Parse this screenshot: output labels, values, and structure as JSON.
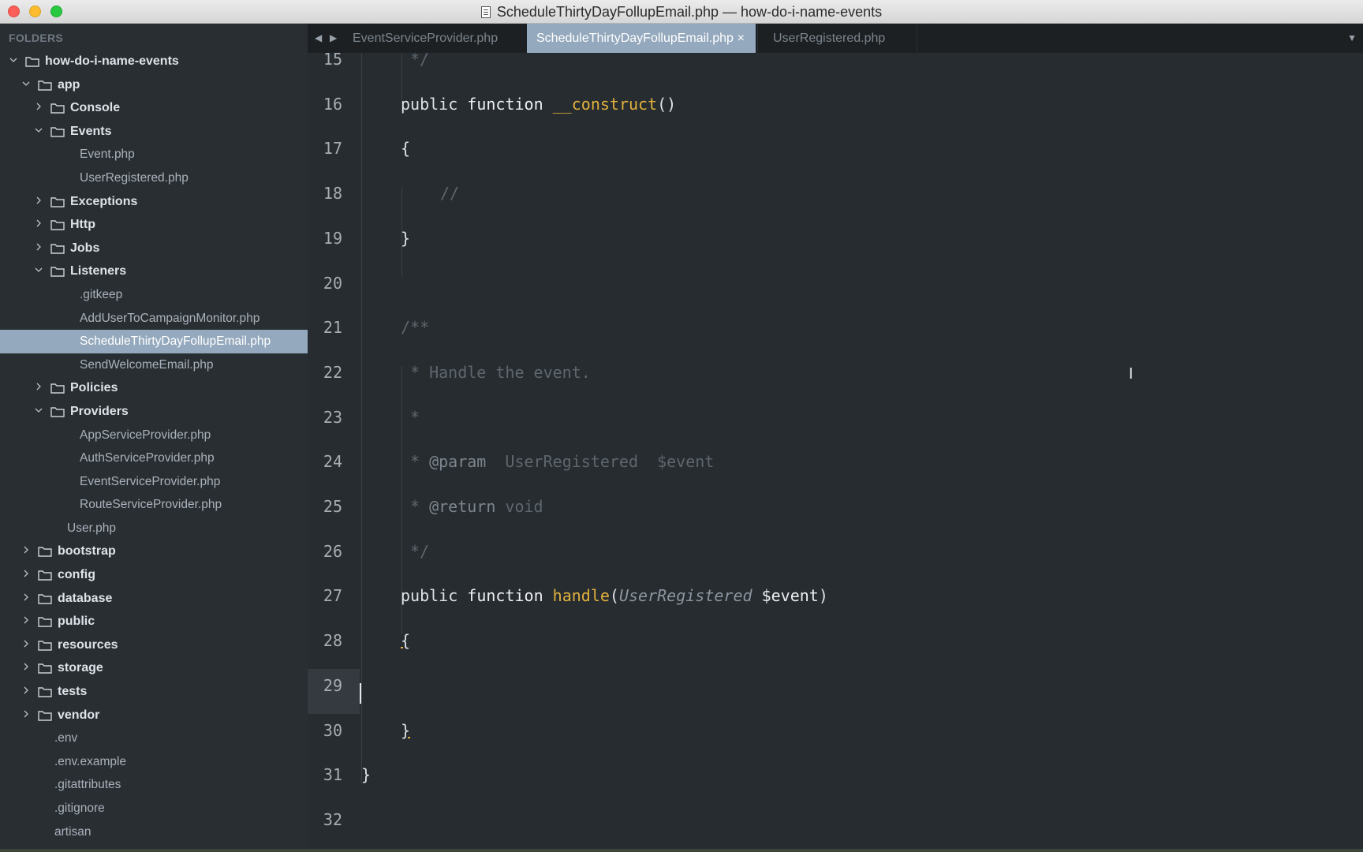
{
  "window": {
    "title": "ScheduleThirtyDayFollupEmail.php — how-do-i-name-events"
  },
  "sidebar": {
    "header": "FOLDERS",
    "items": [
      {
        "label": "how-do-i-name-events",
        "kind": "folder",
        "depth": 0,
        "expanded": true
      },
      {
        "label": "app",
        "kind": "folder",
        "depth": 1,
        "expanded": true
      },
      {
        "label": "Console",
        "kind": "folder",
        "depth": 2,
        "expanded": false
      },
      {
        "label": "Events",
        "kind": "folder",
        "depth": 2,
        "expanded": true
      },
      {
        "label": "Event.php",
        "kind": "file",
        "depth": 3
      },
      {
        "label": "UserRegistered.php",
        "kind": "file",
        "depth": 3
      },
      {
        "label": "Exceptions",
        "kind": "folder",
        "depth": 2,
        "expanded": false
      },
      {
        "label": "Http",
        "kind": "folder",
        "depth": 2,
        "expanded": false
      },
      {
        "label": "Jobs",
        "kind": "folder",
        "depth": 2,
        "expanded": false
      },
      {
        "label": "Listeners",
        "kind": "folder",
        "depth": 2,
        "expanded": true
      },
      {
        "label": ".gitkeep",
        "kind": "file",
        "depth": 3
      },
      {
        "label": "AddUserToCampaignMonitor.php",
        "kind": "file",
        "depth": 3
      },
      {
        "label": "ScheduleThirtyDayFollupEmail.php",
        "kind": "file",
        "depth": 3,
        "selected": true
      },
      {
        "label": "SendWelcomeEmail.php",
        "kind": "file",
        "depth": 3
      },
      {
        "label": "Policies",
        "kind": "folder",
        "depth": 2,
        "expanded": false
      },
      {
        "label": "Providers",
        "kind": "folder",
        "depth": 2,
        "expanded": true
      },
      {
        "label": "AppServiceProvider.php",
        "kind": "file",
        "depth": 3
      },
      {
        "label": "AuthServiceProvider.php",
        "kind": "file",
        "depth": 3
      },
      {
        "label": "EventServiceProvider.php",
        "kind": "file",
        "depth": 3
      },
      {
        "label": "RouteServiceProvider.php",
        "kind": "file",
        "depth": 3
      },
      {
        "label": "User.php",
        "kind": "file",
        "depth": 2
      },
      {
        "label": "bootstrap",
        "kind": "folder",
        "depth": 1,
        "expanded": false
      },
      {
        "label": "config",
        "kind": "folder",
        "depth": 1,
        "expanded": false
      },
      {
        "label": "database",
        "kind": "folder",
        "depth": 1,
        "expanded": false
      },
      {
        "label": "public",
        "kind": "folder",
        "depth": 1,
        "expanded": false
      },
      {
        "label": "resources",
        "kind": "folder",
        "depth": 1,
        "expanded": false
      },
      {
        "label": "storage",
        "kind": "folder",
        "depth": 1,
        "expanded": false
      },
      {
        "label": "tests",
        "kind": "folder",
        "depth": 1,
        "expanded": false
      },
      {
        "label": "vendor",
        "kind": "folder",
        "depth": 1,
        "expanded": false
      },
      {
        "label": ".env",
        "kind": "file",
        "depth": 1
      },
      {
        "label": ".env.example",
        "kind": "file",
        "depth": 1
      },
      {
        "label": ".gitattributes",
        "kind": "file",
        "depth": 1
      },
      {
        "label": ".gitignore",
        "kind": "file",
        "depth": 1
      },
      {
        "label": "artisan",
        "kind": "file",
        "depth": 1
      }
    ]
  },
  "tabs": [
    {
      "label": "EventServiceProvider.php",
      "active": false
    },
    {
      "label": "ScheduleThirtyDayFollupEmail.php",
      "active": true,
      "close_glyph": "×"
    },
    {
      "label": "UserRegistered.php",
      "active": false
    }
  ],
  "editor": {
    "current_line": 29,
    "lines": [
      {
        "n": "15",
        "text": "*/"
      },
      {
        "n": "16",
        "text": "public function __construct()"
      },
      {
        "n": "17",
        "text": "{"
      },
      {
        "n": "18",
        "text": "//"
      },
      {
        "n": "19",
        "text": "}"
      },
      {
        "n": "20",
        "text": ""
      },
      {
        "n": "21",
        "text": "/**"
      },
      {
        "n": "22",
        "text": "* Handle the event."
      },
      {
        "n": "23",
        "text": "*"
      },
      {
        "n": "24",
        "text": "* @param  UserRegistered  $event"
      },
      {
        "n": "25",
        "text": "* @return void"
      },
      {
        "n": "26",
        "text": "*/"
      },
      {
        "n": "27",
        "text": "public function handle(UserRegistered $event)"
      },
      {
        "n": "28",
        "text": "{"
      },
      {
        "n": "29",
        "text": ""
      },
      {
        "n": "30",
        "text": "}"
      },
      {
        "n": "31",
        "text": "}"
      },
      {
        "n": "32",
        "text": ""
      }
    ],
    "tokens": {
      "public": "public",
      "function": "function",
      "construct_name": "__construct",
      "parens": "()",
      "brace_open": "{",
      "brace_close": "}",
      "comment_slashes": "//",
      "doc_open": "/**",
      "doc_close": "*/",
      "doc_handle": "* Handle the event.",
      "doc_star": "*",
      "doc_param_tag": "@param",
      "doc_param_rest": "  UserRegistered  $event",
      "doc_return_tag": "@return",
      "doc_return_rest": " void",
      "handle_name": "handle",
      "paren_open": "(",
      "param_type": "UserRegistered",
      "param_var": "$event",
      "paren_close": ")"
    }
  },
  "colors": {
    "sidebar_bg": "#292e33",
    "editor_bg": "#272c30",
    "selection": "#94a9bd",
    "function_name": "#e2b13c"
  }
}
